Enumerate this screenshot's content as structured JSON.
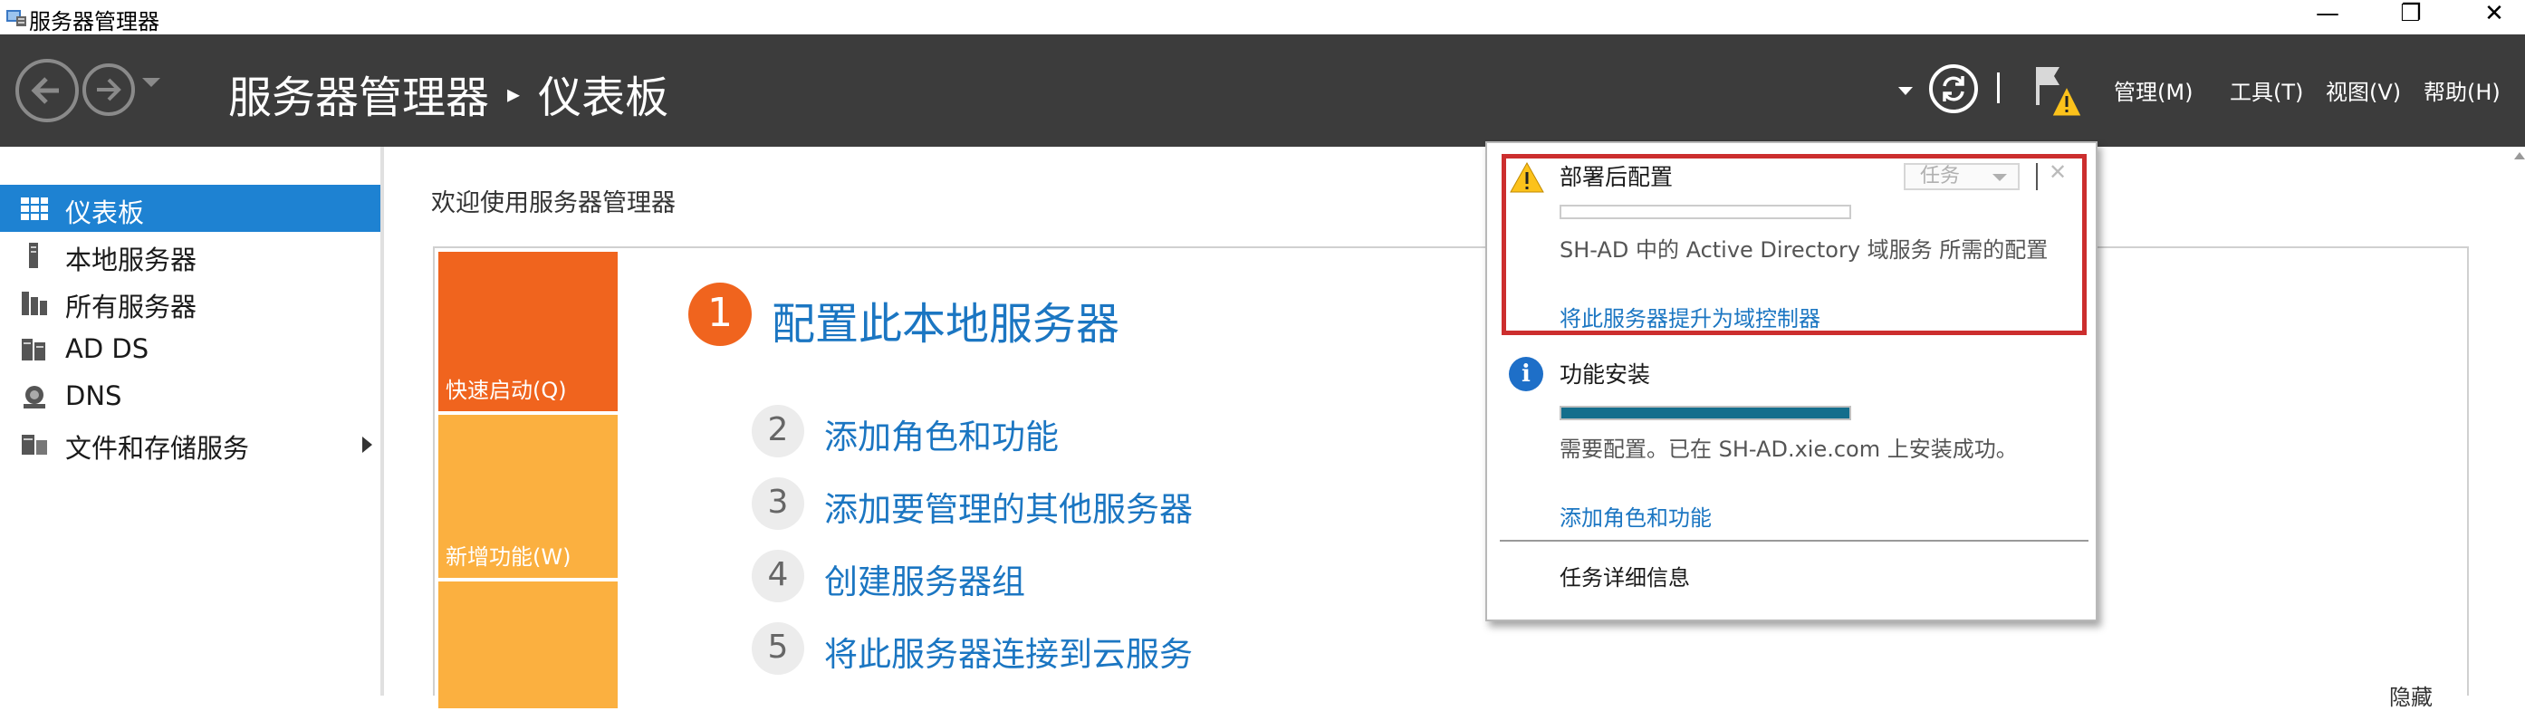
{
  "window": {
    "title": "服务器管理器",
    "controls": {
      "minimize": "—",
      "restore": "❐",
      "close": "✕"
    }
  },
  "header": {
    "breadcrumb_root": "服务器管理器",
    "breadcrumb_separator": "▸",
    "breadcrumb_current": "仪表板",
    "menus": [
      "管理(M)",
      "工具(T)",
      "视图(V)",
      "帮助(H)"
    ]
  },
  "sidebar": {
    "items": [
      {
        "label": "仪表板",
        "icon": "dashboard-icon",
        "selected": true
      },
      {
        "label": "本地服务器",
        "icon": "server-icon",
        "selected": false
      },
      {
        "label": "所有服务器",
        "icon": "servers-icon",
        "selected": false
      },
      {
        "label": "AD DS",
        "icon": "ad-ds-icon",
        "selected": false
      },
      {
        "label": "DNS",
        "icon": "dns-icon",
        "selected": false
      },
      {
        "label": "文件和存储服务",
        "icon": "storage-icon",
        "selected": false,
        "expandable": true
      }
    ]
  },
  "main": {
    "welcome_title": "欢迎使用服务器管理器",
    "tiles": {
      "quick_start": "快速启动(Q)",
      "whats_new": "新增功能(W)"
    },
    "step1": {
      "number": "1",
      "label": "配置此本地服务器"
    },
    "steps": [
      {
        "number": "2",
        "label": "添加角色和功能"
      },
      {
        "number": "3",
        "label": "添加要管理的其他服务器"
      },
      {
        "number": "4",
        "label": "创建服务器组"
      },
      {
        "number": "5",
        "label": "将此服务器连接到云服务"
      }
    ],
    "hide_link": "隐藏"
  },
  "notifications": {
    "post_deploy": {
      "title": "部署后配置",
      "task_button": "任务",
      "close": "✕",
      "message": "SH-AD 中的 Active Directory 域服务 所需的配置",
      "link": "将此服务器提升为域控制器",
      "progress": 0
    },
    "feature_install": {
      "title": "功能安装",
      "message": "需要配置。已在 SH-AD.xie.com 上安装成功。",
      "link": "添加角色和功能",
      "progress": 1.0
    },
    "task_details": "任务详细信息"
  },
  "colors": {
    "header_bg": "#3c3c3c",
    "selected_nav": "#1e82d2",
    "quick_start_tile": "#f0641e",
    "new_tile": "#fbb040",
    "link": "#1b76c2",
    "highlight_border": "#cc2e2e",
    "progress_fill": "#146e8c"
  }
}
